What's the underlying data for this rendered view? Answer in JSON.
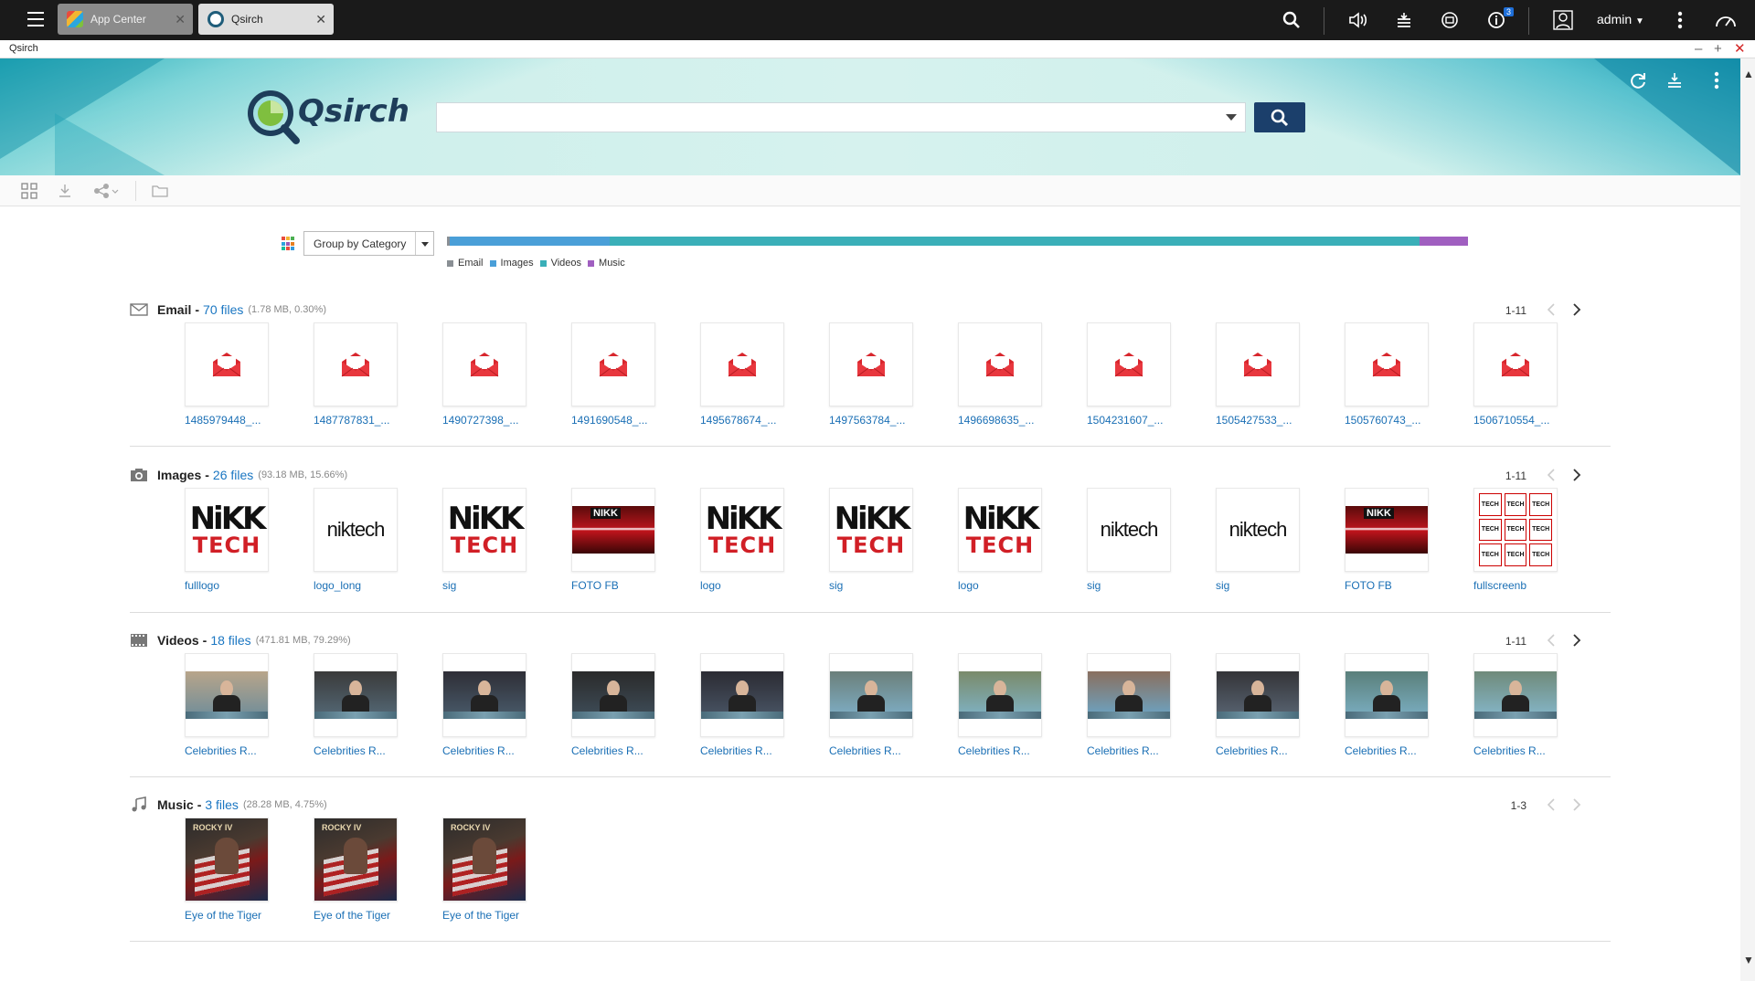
{
  "topbar": {
    "tabs": [
      {
        "label": "App Center",
        "icon": "app-center-icon"
      },
      {
        "label": "Qsirch",
        "icon": "qsirch-icon"
      }
    ],
    "notification_count": "3",
    "user": "admin"
  },
  "window": {
    "title": "Qsirch"
  },
  "header": {
    "logo_text": "Qsirch",
    "search": {
      "value": "",
      "placeholder": ""
    }
  },
  "summary": {
    "group_by": "Group by Category",
    "bar": [
      {
        "name": "Email",
        "fraction": 0.003,
        "color": "#8a8f94"
      },
      {
        "name": "Images",
        "fraction": 0.1566,
        "color": "#4a9fd8"
      },
      {
        "name": "Videos",
        "fraction": 0.7929,
        "color": "#3aafb8"
      },
      {
        "name": "Music",
        "fraction": 0.0475,
        "color": "#a05fc0"
      }
    ]
  },
  "sections": [
    {
      "title": "Email",
      "count": "70 files",
      "meta": "(1.78 MB, 0.30%)",
      "range": "1-11",
      "items": [
        "1485979448_...",
        "1487787831_...",
        "1490727398_...",
        "1491690548_...",
        "1495678674_...",
        "1497563784_...",
        "1496698635_...",
        "1504231607_...",
        "1505427533_...",
        "1505760743_...",
        "1506710554_..."
      ]
    },
    {
      "title": "Images",
      "count": "26 files",
      "meta": "(93.18 MB, 15.66%)",
      "range": "1-11",
      "items": [
        "fulllogo",
        "logo_long",
        "sig",
        "FOTO FB",
        "logo",
        "sig",
        "logo",
        "sig",
        "sig",
        "FOTO FB",
        "fullscreenb"
      ]
    },
    {
      "title": "Videos",
      "count": "18 files",
      "meta": "(471.81 MB, 79.29%)",
      "range": "1-11",
      "items": [
        "Celebrities R...",
        "Celebrities R...",
        "Celebrities R...",
        "Celebrities R...",
        "Celebrities R...",
        "Celebrities R...",
        "Celebrities R...",
        "Celebrities R...",
        "Celebrities R...",
        "Celebrities R...",
        "Celebrities R..."
      ]
    },
    {
      "title": "Music",
      "count": "3 files",
      "meta": "(28.28 MB, 4.75%)",
      "range": "1-3",
      "items": [
        "Eye of the Tiger",
        "Eye of the Tiger",
        "Eye of the Tiger"
      ]
    }
  ],
  "thumb_text": {
    "nikk_top": "NiKK",
    "nikk_bottom": "TECH",
    "nikk_logo_word": "niktech",
    "nikk_banner_word": "NIKK",
    "album_title": "ROCKY IV"
  }
}
